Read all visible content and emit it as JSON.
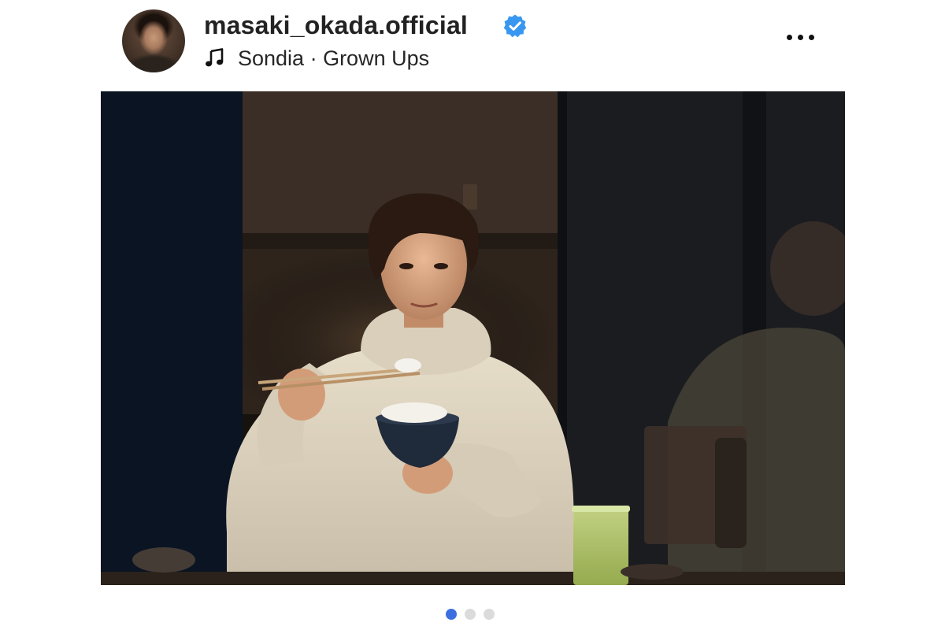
{
  "post": {
    "username": "masaki_okada.official",
    "verified": true,
    "audio": {
      "artist": "Sondia",
      "separator": "·",
      "track": "Grown Ups",
      "display": "Sondia · Grown Ups"
    }
  },
  "media": {
    "muted": true,
    "carousel": {
      "total": 3,
      "active_index": 0
    }
  },
  "colors": {
    "verified_badge": "#3897f0",
    "active_dot": "#3b6fe0",
    "inactive_dot": "#dbdbdb"
  },
  "icons": {
    "verified": "verified-badge-icon",
    "music": "music-note-icon",
    "more": "more-options-icon",
    "mute": "speaker-muted-icon"
  }
}
